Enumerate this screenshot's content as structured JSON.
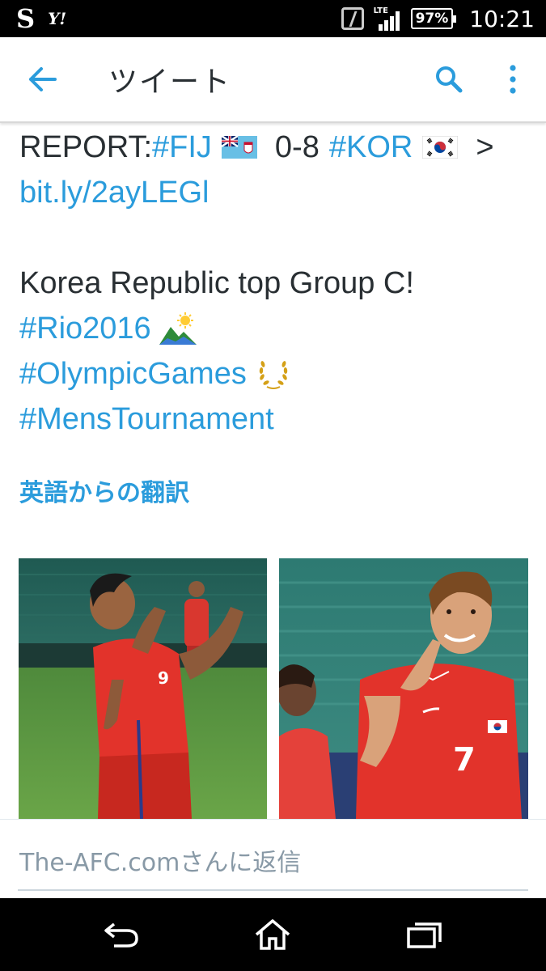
{
  "status_bar": {
    "carrier_icon": "S",
    "yahoo_icon": "Y!",
    "network": "LTE",
    "battery": "97%",
    "time": "10:21"
  },
  "header": {
    "title": "ツイート",
    "back_icon": "arrow-left-icon",
    "search_icon": "search-icon",
    "more_icon": "more-vertical-icon"
  },
  "tweet": {
    "line1_prefix": "REPORT: ",
    "hashtag_fij": "#FIJ",
    "score": "0-8",
    "hashtag_kor": "#KOR",
    "arrow": ">",
    "link": "bit.ly/2ayLEGl",
    "headline": "Korea Republic top Group C!",
    "hashtag_rio": "#Rio2016",
    "hashtag_olympic": "#OlympicGames",
    "hashtag_mens": "#MensTournament",
    "translate_label": "英語からの翻訳"
  },
  "reply": {
    "placeholder": "The-AFC.comさんに返信"
  },
  "colors": {
    "link": "#2b9cdc",
    "text": "#292f33",
    "muted": "#8899a6"
  }
}
